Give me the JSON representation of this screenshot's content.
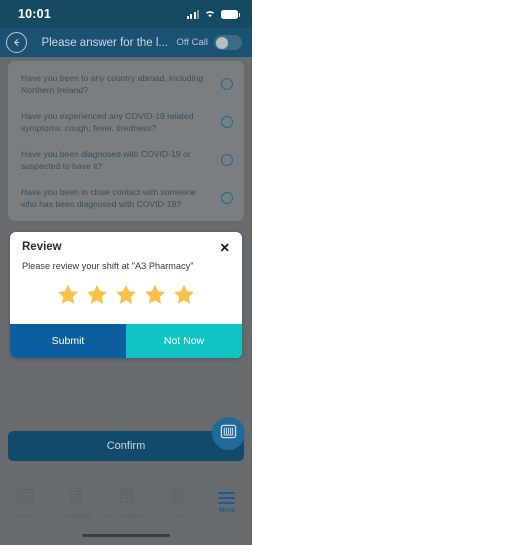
{
  "status_bar": {
    "time": "10:01",
    "icons": [
      "cellular-signal-icon",
      "wifi-icon",
      "battery-icon"
    ]
  },
  "header": {
    "back_icon": "back-arrow-icon",
    "title": "Please answer for the l...",
    "toggle_label": "Off Call",
    "toggle_state": "off"
  },
  "questions": {
    "items": [
      {
        "text": "Have you been to any country abroad, including Northern Ireland?",
        "selected": false
      },
      {
        "text": "Have you experienced any COVID-19 related symptoms: cough, fever, tiredness?",
        "selected": false
      },
      {
        "text": "Have you been diagnosed with COVID-19 or suspected to have it?",
        "selected": false
      },
      {
        "text": "Have you been in close contact with someone who has been diagnosed with COVID-19?",
        "selected": false
      }
    ]
  },
  "modal": {
    "title": "Review",
    "close_icon": "close-icon",
    "message": "Please review your shift at \"A3 Pharmacy\"",
    "rating": 5,
    "max_rating": 5,
    "star_color": "#fbc martinez",
    "submit_label": "Submit",
    "not_now_label": "Not Now"
  },
  "footer": {
    "confirm_label": "Confirm",
    "fab_icon": "barcode-scanner-icon"
  },
  "tab_bar": {
    "items": [
      {
        "label": "Locums",
        "icon": "calendar-icon",
        "active": false
      },
      {
        "label": "Availability",
        "icon": "document-icon",
        "active": false
      },
      {
        "label": "My Locations",
        "icon": "store-icon",
        "active": false
      },
      {
        "label": "Jobs",
        "icon": "list-icon",
        "active": false
      },
      {
        "label": "More",
        "icon": "hamburger-icon",
        "active": true
      }
    ]
  },
  "colors": {
    "status_bar": "#154a63",
    "nav_bar": "#1b5274",
    "overlay": "#676b6d",
    "card": "#7a7e80",
    "accent_blue": "#0b5f9e",
    "accent_teal": "#10c4c4",
    "star": "#fbc04a",
    "radio_blue": "#1f6a96"
  }
}
